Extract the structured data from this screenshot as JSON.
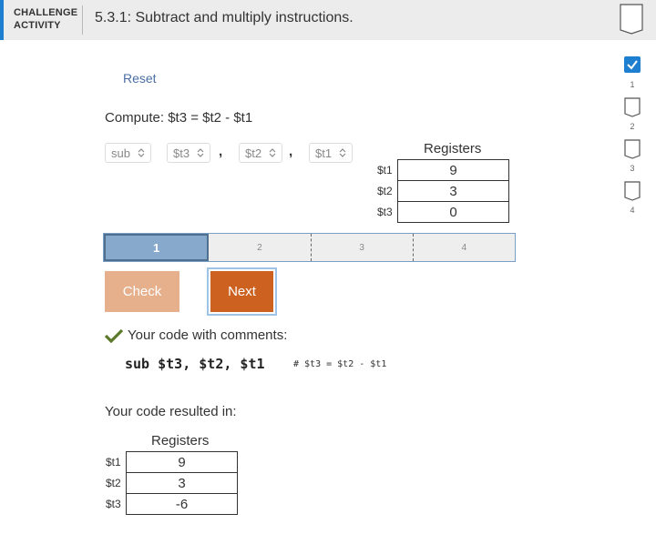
{
  "header": {
    "label_line1": "CHALLENGE",
    "label_line2": "ACTIVITY",
    "title": "5.3.1: Subtract and multiply instructions."
  },
  "reset_label": "Reset",
  "prompt": "Compute: $t3 = $t2 - $t1",
  "instruction": {
    "op": "sub",
    "rd": "$t3",
    "rs": "$t2",
    "rt": "$t1",
    "sep": ","
  },
  "registers_top": {
    "title": "Registers",
    "rows": [
      {
        "name": "$t1",
        "value": "9"
      },
      {
        "name": "$t2",
        "value": "3"
      },
      {
        "name": "$t3",
        "value": "0"
      }
    ]
  },
  "steps": [
    "1",
    "2",
    "3",
    "4"
  ],
  "active_step": 1,
  "buttons": {
    "check": "Check",
    "next": "Next"
  },
  "feedback": "Your code with comments:",
  "code_line": "sub $t3, $t2, $t1",
  "code_comment": "# $t3 = $t2 - $t1",
  "result_label": "Your code resulted in:",
  "registers_result": {
    "title": "Registers",
    "rows": [
      {
        "name": "$t1",
        "value": "9"
      },
      {
        "name": "$t2",
        "value": "3"
      },
      {
        "name": "$t3",
        "value": "-6"
      }
    ]
  },
  "sidebar": {
    "levels": [
      {
        "num": "1",
        "done": true
      },
      {
        "num": "2",
        "done": false
      },
      {
        "num": "3",
        "done": false
      },
      {
        "num": "4",
        "done": false
      }
    ]
  },
  "colors": {
    "accent": "#1e7fd0",
    "check_button": "#e6b08d",
    "next_button": "#cc6120",
    "active_step": "#87a9cc",
    "success": "#5a7a2a"
  }
}
